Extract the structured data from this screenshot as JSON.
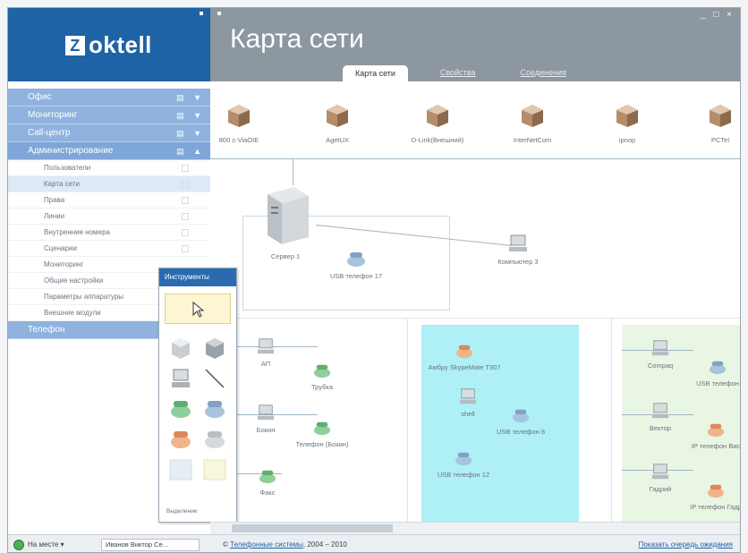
{
  "app": {
    "logo_text": "oktell",
    "logo_mark": "Z",
    "title": "Карта сети",
    "window_controls": "_ □ ×"
  },
  "tabs": [
    {
      "label": "Карта сети",
      "active": true
    },
    {
      "label": "Свойства",
      "active": false
    },
    {
      "label": "Соединения",
      "active": false
    }
  ],
  "sidebar": {
    "sections": [
      {
        "label": "Офис",
        "controls": "▤ ▼"
      },
      {
        "label": "Мониторинг",
        "controls": "▤ ▼"
      },
      {
        "label": "Call-центр",
        "controls": "▤ ▼"
      },
      {
        "label": "Администрирование",
        "controls": "▤ ▲"
      }
    ],
    "items": [
      "Пользователи",
      "Карта сети",
      "Права",
      "Линии",
      "Внутренние номера",
      "Сценарии",
      "Мониторинг",
      "Общие настройки",
      "Параметры аппаратуры",
      "Внешние модули"
    ],
    "selected_item": "Карта сети",
    "bottom_section": "Телефон"
  },
  "map": {
    "gateways": [
      "800 с-ViaOIE",
      "AgetUX",
      "D-Link(Внешний)",
      "InterNetCom",
      "ipnop",
      "PCTel"
    ],
    "server_label": "Сервер 1",
    "server_phone": "USB телефон 17",
    "computer_label": "Компьютер 3",
    "left_nodes": [
      "АП",
      "Трубка",
      "Бокин",
      "Телефон (Бокин)",
      "Факс"
    ],
    "cyan_nodes": [
      "Амбру SkypeMate T307",
      "shell",
      "USB телефон 8",
      "USB телефон 12"
    ],
    "green_nodes": [
      "Compaq",
      "USB телефон",
      "Вектор",
      "IP телефон Вис",
      "Гадрий",
      "IP телефон Гадр"
    ]
  },
  "tools": {
    "title": "Инструменты",
    "footer": "Выделение"
  },
  "status": {
    "state": "На месте",
    "state_arrow": "▾",
    "user": "Иванов Виктор Се...",
    "copyright_prefix": "© ",
    "copyright_link": "Телефонные системы",
    "copyright_years": ", 2004 – 2010",
    "queue_link": "Показать очередь ожидания"
  },
  "colors": {
    "brand_blue": "#1e63a6",
    "header_gray": "#8d979f",
    "sidebar_blue": "#8fb3de",
    "zone_cyan": "#aef0f6",
    "zone_green": "#e9f6e3",
    "status_green": "#4caf50"
  }
}
